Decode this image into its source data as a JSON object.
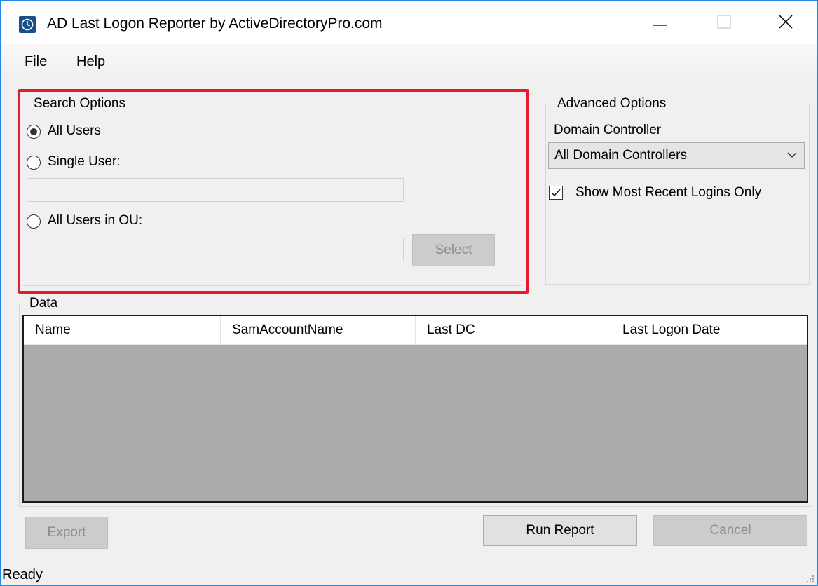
{
  "window": {
    "title": "AD Last Logon Reporter by ActiveDirectoryPro.com",
    "accent": "#1e88e5",
    "highlight_color": "#e8192c"
  },
  "menu": {
    "items": [
      "File",
      "Help"
    ]
  },
  "search_options": {
    "legend": "Search Options",
    "all_users_label": "All Users",
    "single_user_label": "Single User:",
    "single_user_value": "",
    "ou_label": "All Users in OU:",
    "ou_value": "",
    "select_label": "Select",
    "selected": "All Users"
  },
  "advanced_options": {
    "legend": "Advanced Options",
    "dc_label": "Domain Controller",
    "dc_selected": "All Domain Controllers",
    "recent_checkbox_label": "Show Most Recent Logins Only",
    "recent_checked": true
  },
  "data": {
    "legend": "Data",
    "columns": [
      "Name",
      "SamAccountName",
      "Last DC",
      "Last Logon Date"
    ],
    "rows": []
  },
  "buttons": {
    "export": "Export",
    "run_report": "Run Report",
    "cancel": "Cancel"
  },
  "status": {
    "text": "Ready"
  },
  "icons": {
    "app": "clock-icon",
    "minimize": "minimize-icon",
    "maximize": "maximize-icon",
    "close": "close-icon",
    "dropdown": "chevron-down-icon",
    "grip": "resize-grip-icon"
  }
}
